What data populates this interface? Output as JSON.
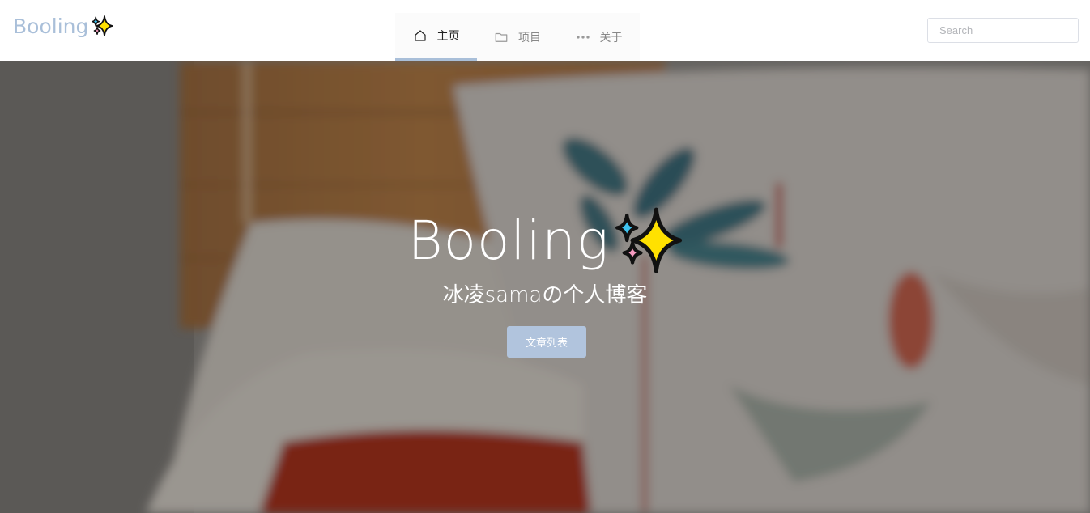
{
  "header": {
    "logo_text": "Booling",
    "nav": [
      {
        "label": "主页",
        "icon": "home-icon",
        "active": true
      },
      {
        "label": "项目",
        "icon": "folder-icon",
        "active": false
      },
      {
        "label": "关于",
        "icon": "more-icon",
        "active": false
      }
    ],
    "search_placeholder": "Search"
  },
  "hero": {
    "title": "Booling",
    "subtitle": "冰凌samaの个人博客",
    "button_label": "文章列表"
  },
  "colors": {
    "accent": "#a9bfd9",
    "button": "#b1c4dd",
    "sparkle_yellow": "#ffe100",
    "sparkle_blue": "#3ec3f0",
    "sparkle_pink": "#f59ac0"
  }
}
